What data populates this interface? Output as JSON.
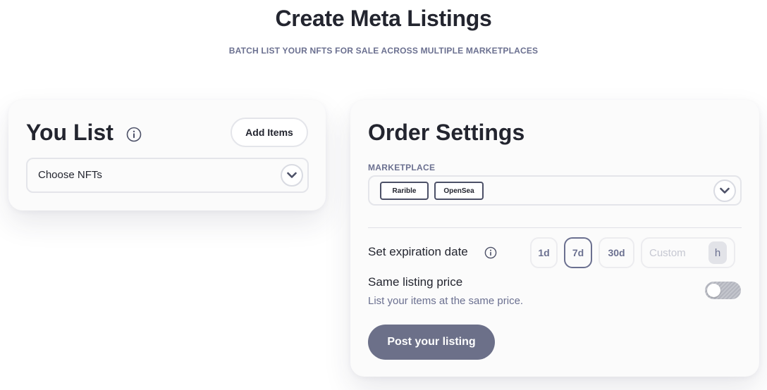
{
  "header": {
    "title": "Create Meta Listings",
    "subtitle": "BATCH LIST YOUR NFTS FOR SALE ACROSS MULTIPLE MARKETPLACES"
  },
  "you_list": {
    "title": "You List",
    "add_items_label": "Add Items",
    "choose_nfts_label": "Choose NFTs"
  },
  "order_settings": {
    "title": "Order Settings",
    "marketplace_label": "MARKETPLACE",
    "marketplaces": [
      "Rarible",
      "OpenSea"
    ],
    "expiration_label": "Set expiration date",
    "durations": [
      "1d",
      "7d",
      "30d"
    ],
    "selected_duration": "7d",
    "custom_placeholder": "Custom",
    "custom_unit": "h",
    "same_price_label": "Same listing price",
    "same_price_desc": "List your items at the same price.",
    "same_price_enabled": false,
    "post_label": "Post your listing"
  },
  "icons": {
    "info": "info-icon",
    "chevron": "chevron-down-icon"
  },
  "colors": {
    "text_dark": "#23252f",
    "text_muted": "#6b7090",
    "button_primary": "#6c7089"
  }
}
